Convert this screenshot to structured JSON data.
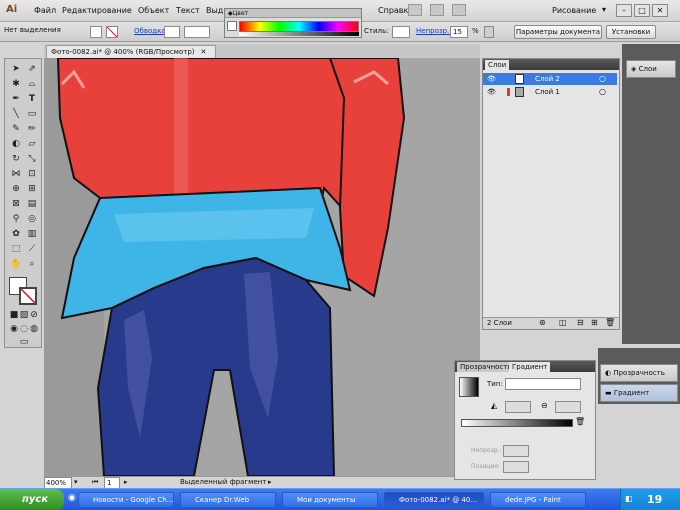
{
  "menubar": {
    "logo": "Ai",
    "items": [
      "Файл",
      "Редактирование",
      "Объект",
      "Текст",
      "Выд"
    ],
    "help": "Справка",
    "workspace": "Рисование"
  },
  "color_panel": {
    "title": "Цвет"
  },
  "control_bar": {
    "selection_label": "Нет выделения",
    "stroke_label": "Обводка",
    "style_label": "Стиль:",
    "opacity_label": "Непрозр.:",
    "opacity_value": "15",
    "percent": "%",
    "doc_settings_button": "Параметры документа",
    "preferences_button": "Установки"
  },
  "document": {
    "tab_title": "Фото-0082.ai* @ 400% (RGB/Просмотр)",
    "zoom": "400%",
    "page": "1",
    "status": "Выделенный фрагмент"
  },
  "layers_panel": {
    "tab": "Слои",
    "layers": [
      {
        "name": "Слой 2",
        "selected": true,
        "color": "#3b7bdc"
      },
      {
        "name": "Слой 1",
        "selected": false,
        "color": "#d83a3a"
      }
    ],
    "count": "2 Слои"
  },
  "right_dock": {
    "layers_button": "Слои"
  },
  "gradient_panel": {
    "tabs": [
      "Прозрачность",
      "Градиент"
    ],
    "type_label": "Тип:",
    "opacity_label": "Непрозр.:",
    "location_label": "Позиция:"
  },
  "collapsed_panels": {
    "items": [
      "Прозрачность",
      "Градиент"
    ]
  },
  "taskbar": {
    "start": "пуск",
    "tasks": [
      "Новости - Google Ch...",
      "Сканер Dr.Web",
      "Мои документы",
      "Фото-0082.ai* @ 40...",
      "dede.JPG - Paint"
    ],
    "time": "19"
  },
  "colors": {
    "shirt": "#e8403b",
    "skirt": "#3fb4e6",
    "pants": "#283a8c",
    "wall": "#a4a4a4"
  }
}
